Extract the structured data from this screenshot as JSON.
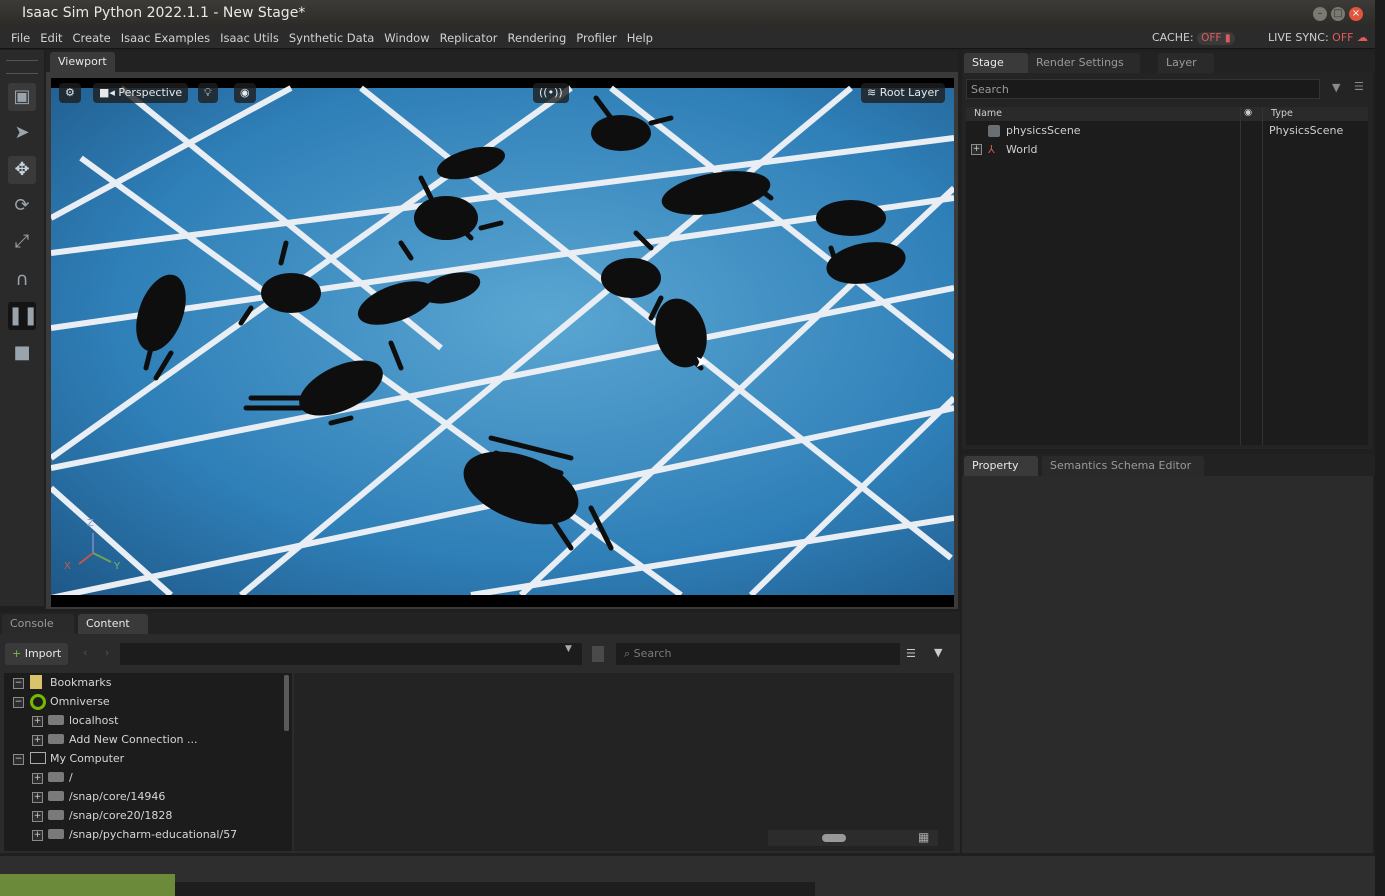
{
  "window": {
    "title": "Isaac Sim Python 2022.1.1 - New Stage*"
  },
  "menu": {
    "items": [
      "File",
      "Edit",
      "Create",
      "Isaac Examples",
      "Isaac Utils",
      "Synthetic Data",
      "Window",
      "Replicator",
      "Rendering",
      "Profiler",
      "Help"
    ],
    "cache_label": "CACHE:",
    "cache_value": "OFF",
    "live_sync_label": "LIVE SYNC:",
    "live_sync_value": "OFF"
  },
  "toolbar": {
    "tools": [
      "cube-icon",
      "select-icon",
      "move-icon",
      "rotate-icon",
      "scale-icon",
      "snap-icon",
      "pause-icon",
      "stop-icon"
    ]
  },
  "viewport": {
    "tab": "Viewport",
    "camera": "Perspective",
    "layer": "Root Layer",
    "axis_z": "Z",
    "axis_x": "X",
    "axis_y": "Y"
  },
  "stage": {
    "tabs": [
      "Stage",
      "Render Settings",
      "Layer"
    ],
    "search_placeholder": "Search",
    "col_name": "Name",
    "col_type": "Type",
    "rows": [
      {
        "name": "physicsScene",
        "type": "PhysicsScene"
      },
      {
        "name": "World",
        "type": ""
      }
    ]
  },
  "property": {
    "tabs": [
      "Property",
      "Semantics Schema Editor"
    ]
  },
  "bottom": {
    "tabs": [
      "Console",
      "Content"
    ]
  },
  "content": {
    "import_label": "Import",
    "search_placeholder": "Search",
    "tree": [
      {
        "label": "Bookmarks"
      },
      {
        "label": "Omniverse"
      },
      {
        "label": "localhost"
      },
      {
        "label": "Add New Connection ..."
      },
      {
        "label": "My Computer"
      },
      {
        "label": "/"
      },
      {
        "label": "/snap/core/14946"
      },
      {
        "label": "/snap/core20/1828"
      },
      {
        "label": "/snap/pycharm-educational/57"
      }
    ]
  },
  "colors": {
    "accent_off": "#e05a5a",
    "floor": "#2f7fb8",
    "ground_line": "#e8eef3"
  }
}
